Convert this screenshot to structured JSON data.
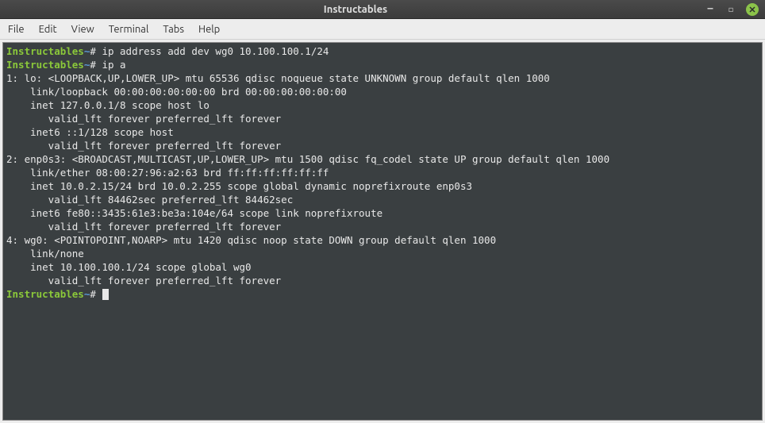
{
  "window": {
    "title": "Instructables"
  },
  "menubar": {
    "file": "File",
    "edit": "Edit",
    "view": "View",
    "terminal": "Terminal",
    "tabs": "Tabs",
    "help": "Help"
  },
  "prompt": {
    "host": "Instructables",
    "sep": "~",
    "hash": "#"
  },
  "commands": {
    "cmd1": "ip address add dev wg0 10.100.100.1/24",
    "cmd2": "ip a"
  },
  "output": {
    "l1": "1: lo: <LOOPBACK,UP,LOWER_UP> mtu 65536 qdisc noqueue state UNKNOWN group default qlen 1000",
    "l2": "    link/loopback 00:00:00:00:00:00 brd 00:00:00:00:00:00",
    "l3": "    inet 127.0.0.1/8 scope host lo",
    "l4": "       valid_lft forever preferred_lft forever",
    "l5": "    inet6 ::1/128 scope host ",
    "l6": "       valid_lft forever preferred_lft forever",
    "l7": "2: enp0s3: <BROADCAST,MULTICAST,UP,LOWER_UP> mtu 1500 qdisc fq_codel state UP group default qlen 1000",
    "l8": "    link/ether 08:00:27:96:a2:63 brd ff:ff:ff:ff:ff:ff",
    "l9": "    inet 10.0.2.15/24 brd 10.0.2.255 scope global dynamic noprefixroute enp0s3",
    "l10": "       valid_lft 84462sec preferred_lft 84462sec",
    "l11": "    inet6 fe80::3435:61e3:be3a:104e/64 scope link noprefixroute ",
    "l12": "       valid_lft forever preferred_lft forever",
    "l13": "4: wg0: <POINTOPOINT,NOARP> mtu 1420 qdisc noop state DOWN group default qlen 1000",
    "l14": "    link/none ",
    "l15": "    inet 10.100.100.1/24 scope global wg0",
    "l16": "       valid_lft forever preferred_lft forever"
  }
}
